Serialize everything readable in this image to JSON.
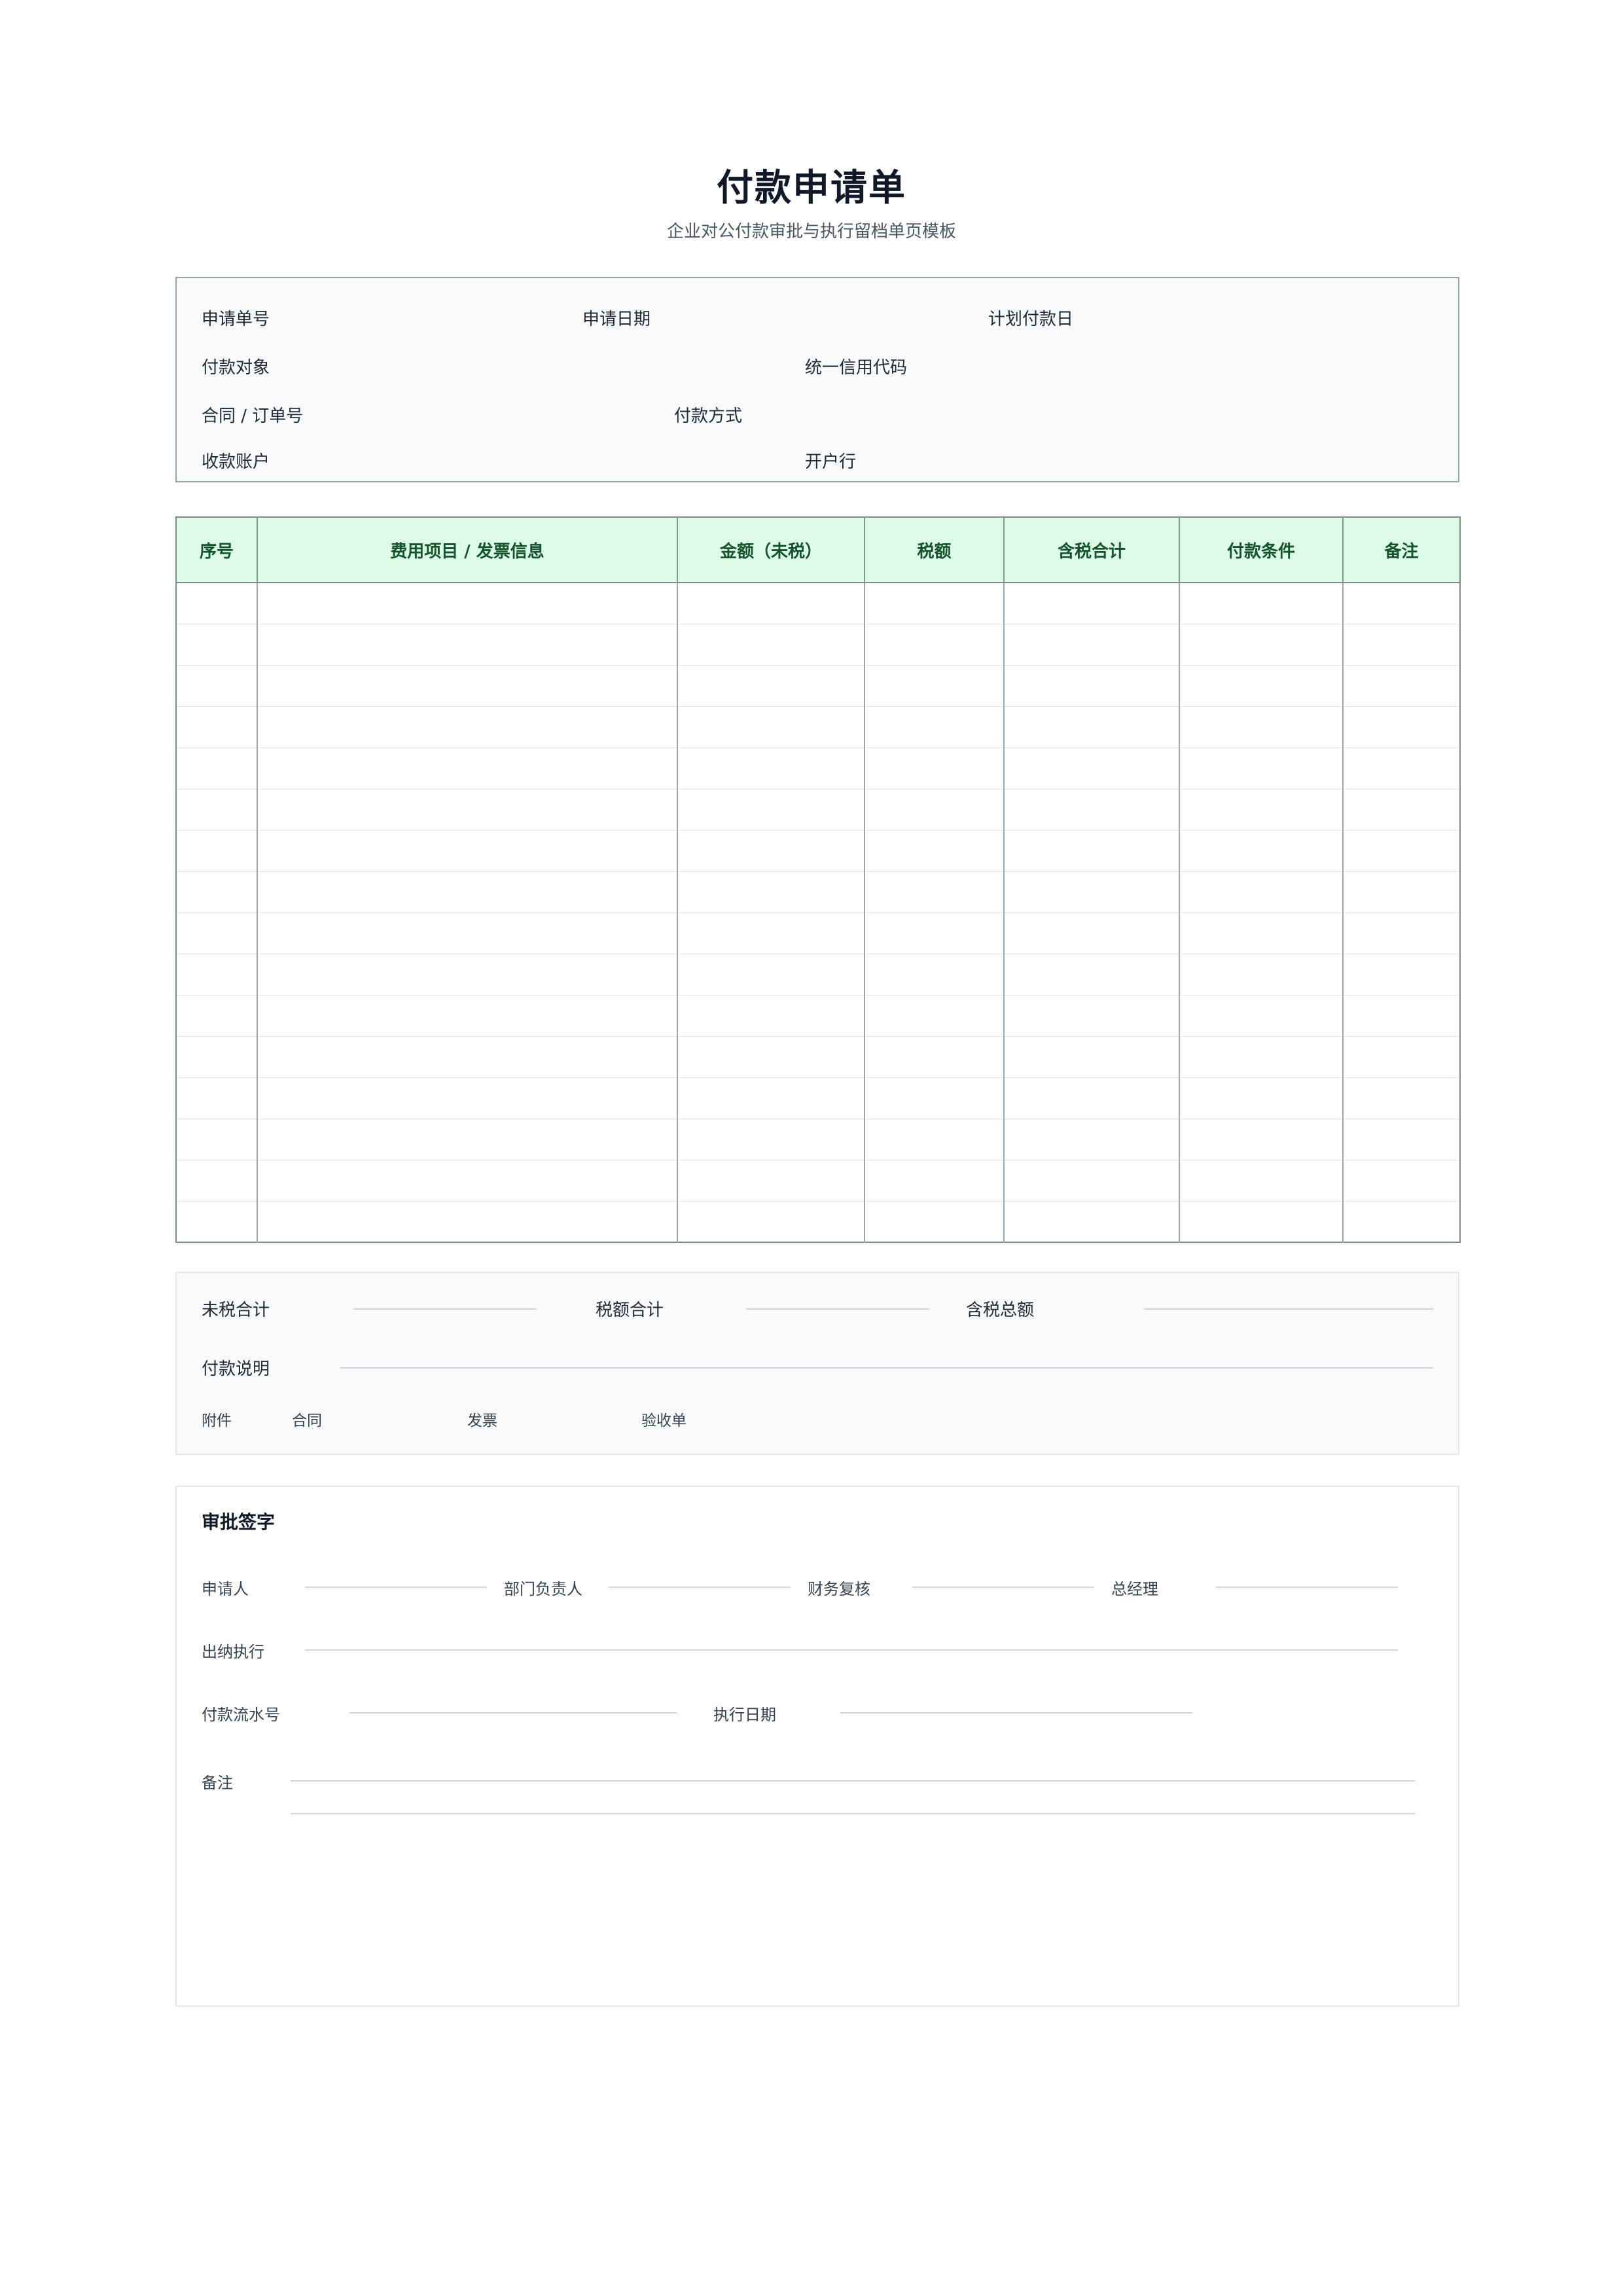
{
  "header": {
    "title": "付款申请单",
    "subtitle": "企业对公付款审批与执行留档单页模板"
  },
  "info": {
    "request_no": "申请单号",
    "request_date": "申请日期",
    "planned_date": "计划付款日",
    "payee": "付款对象",
    "credit_code": "统一信用代码",
    "contract_no": "合同 / 订单号",
    "pay_method": "付款方式",
    "account": "收款账户",
    "bank": "开户行"
  },
  "table": {
    "columns": [
      "序号",
      "费用项目 / 发票信息",
      "金额（未税）",
      "税额",
      "含税合计",
      "付款条件",
      "备注"
    ],
    "row_count": 16
  },
  "totals": {
    "pretax_total": "未税合计",
    "tax_total": "税额合计",
    "grand_total": "含税总额",
    "note": "付款说明",
    "attachments": "附件",
    "att_contract": "合同",
    "att_invoice": "发票",
    "att_acceptance": "验收单"
  },
  "approval": {
    "title": "审批签字",
    "applicant": "申请人",
    "dept_head": "部门负责人",
    "finance_review": "财务复核",
    "general_manager": "总经理",
    "cashier": "出纳执行",
    "serial_no": "付款流水号",
    "exec_date": "执行日期",
    "remarks": "备注"
  }
}
